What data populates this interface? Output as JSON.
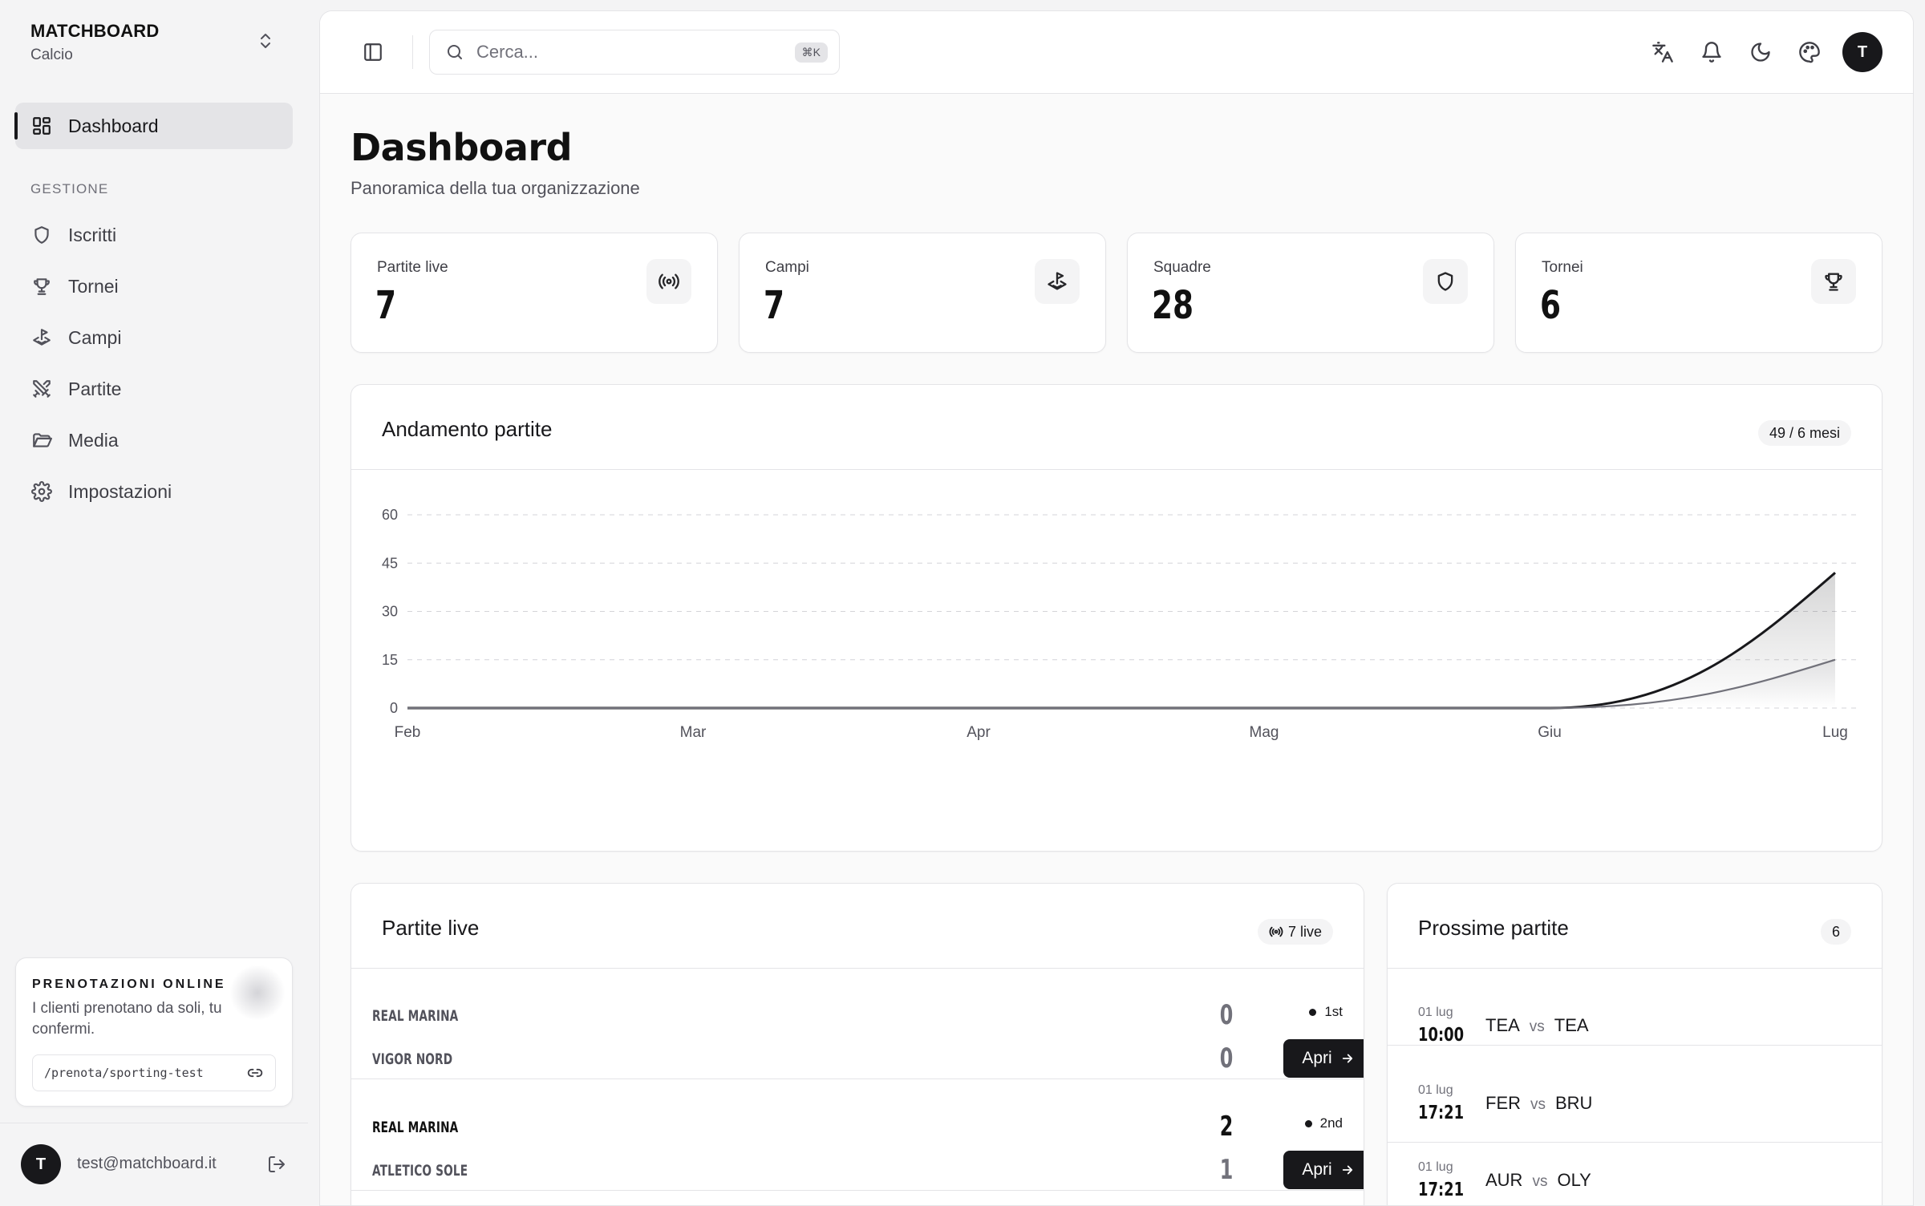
{
  "brand": {
    "name": "MATCHBOARD",
    "sport": "Calcio"
  },
  "sidebar": {
    "active": {
      "label": "Dashboard",
      "icon": "dashboard-icon"
    },
    "section_label": "GESTIONE",
    "items": [
      {
        "label": "Iscritti",
        "icon": "shield-icon"
      },
      {
        "label": "Tornei",
        "icon": "trophy-icon"
      },
      {
        "label": "Campi",
        "icon": "field-icon"
      },
      {
        "label": "Partite",
        "icon": "swords-icon"
      },
      {
        "label": "Media",
        "icon": "folder-icon"
      },
      {
        "label": "Impostazioni",
        "icon": "gear-icon"
      }
    ],
    "promo": {
      "title": "PRENOTAZIONI ONLINE",
      "text": "I clienti prenotano da soli, tu confermi.",
      "url": "/prenota/sporting-test"
    },
    "user": {
      "initial": "T",
      "email": "test@matchboard.it"
    }
  },
  "topbar": {
    "search_placeholder": "Cerca...",
    "search_shortcut": "⌘K",
    "avatar_initial": "T"
  },
  "page": {
    "title": "Dashboard",
    "subtitle": "Panoramica della tua organizzazione"
  },
  "stats": [
    {
      "label": "Partite live",
      "value": "7",
      "icon": "broadcast-icon"
    },
    {
      "label": "Campi",
      "value": "7",
      "icon": "field-icon"
    },
    {
      "label": "Squadre",
      "value": "28",
      "icon": "shield-icon"
    },
    {
      "label": "Tornei",
      "value": "6",
      "icon": "trophy-icon"
    }
  ],
  "chart_card": {
    "title": "Andamento partite",
    "badge": "49 / 6 mesi"
  },
  "chart_data": {
    "type": "area",
    "categories": [
      "Feb",
      "Mar",
      "Apr",
      "Mag",
      "Giu",
      "Lug"
    ],
    "y_ticks": [
      "0",
      "15",
      "30",
      "45",
      "60"
    ],
    "ylim": [
      0,
      60
    ],
    "series": [
      {
        "values": [
          0,
          0,
          0,
          0,
          0,
          42
        ],
        "color": "#18181b"
      },
      {
        "values": [
          0,
          0,
          0,
          0,
          0,
          15
        ],
        "color": "#71717a"
      }
    ],
    "grid": true
  },
  "live_card": {
    "title": "Partite live",
    "badge": "7 live",
    "matches": [
      {
        "home": "REAL MARINA",
        "away": "VIGOR NORD",
        "home_score": "0",
        "away_score": "0",
        "period": "1st",
        "home_win": false,
        "away_win": false,
        "button": "Apri"
      },
      {
        "home": "REAL MARINA",
        "away": "ATLETICO SOLE",
        "home_score": "2",
        "away_score": "1",
        "period": "2nd",
        "home_win": true,
        "away_win": false,
        "button": "Apri"
      }
    ]
  },
  "upcoming_card": {
    "title": "Prossime partite",
    "count": "6",
    "vs_label": "vs",
    "matches": [
      {
        "date": "01 lug",
        "time": "10:00",
        "home": "TEA",
        "away": "TEA"
      },
      {
        "date": "01 lug",
        "time": "17:21",
        "home": "FER",
        "away": "BRU"
      },
      {
        "date": "01 lug",
        "time": "17:21",
        "home": "AUR",
        "away": "OLY"
      }
    ]
  }
}
